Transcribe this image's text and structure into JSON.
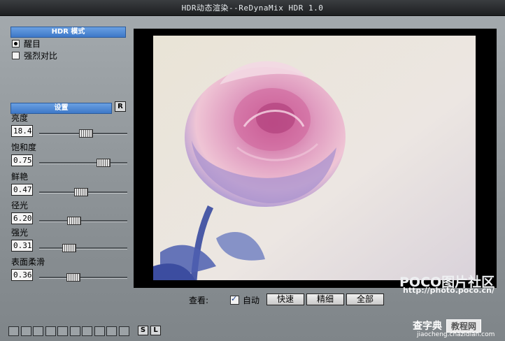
{
  "window": {
    "title": "HDR动态渲染--ReDynaMix HDR 1.0"
  },
  "hdr_mode": {
    "header": "HDR 模式",
    "options": [
      {
        "label": "醒目",
        "selected": true
      },
      {
        "label": "强烈对比",
        "selected": false
      }
    ]
  },
  "settings": {
    "header": "设置",
    "reset_label": "R",
    "items": [
      {
        "label": "亮度",
        "value": "18.4",
        "level": 0.52
      },
      {
        "label": "饱和度",
        "value": "0.75",
        "level": 0.72
      },
      {
        "label": "鲜艳",
        "value": "0.47",
        "level": 0.47
      },
      {
        "label": "径光",
        "value": "6.20",
        "level": 0.39
      },
      {
        "label": "强光",
        "value": "0.31",
        "level": 0.33
      },
      {
        "label": "表面柔滑",
        "value": "0.36",
        "level": 0.38
      }
    ]
  },
  "view": {
    "label": "查看:",
    "auto_label": "自动",
    "auto_checked": true,
    "buttons": [
      "快速",
      "精细",
      "全部"
    ]
  },
  "bottom": {
    "slot_count": 10,
    "save_label": "S",
    "load_label": "L"
  },
  "watermarks": {
    "poco": "POCO图片社区",
    "poco_url": "http://photo.poco.cn/",
    "chazidian": "查字典",
    "chazidian_tag": "教程网",
    "chazidian_url": "jiaocheng.chazidian.com"
  }
}
